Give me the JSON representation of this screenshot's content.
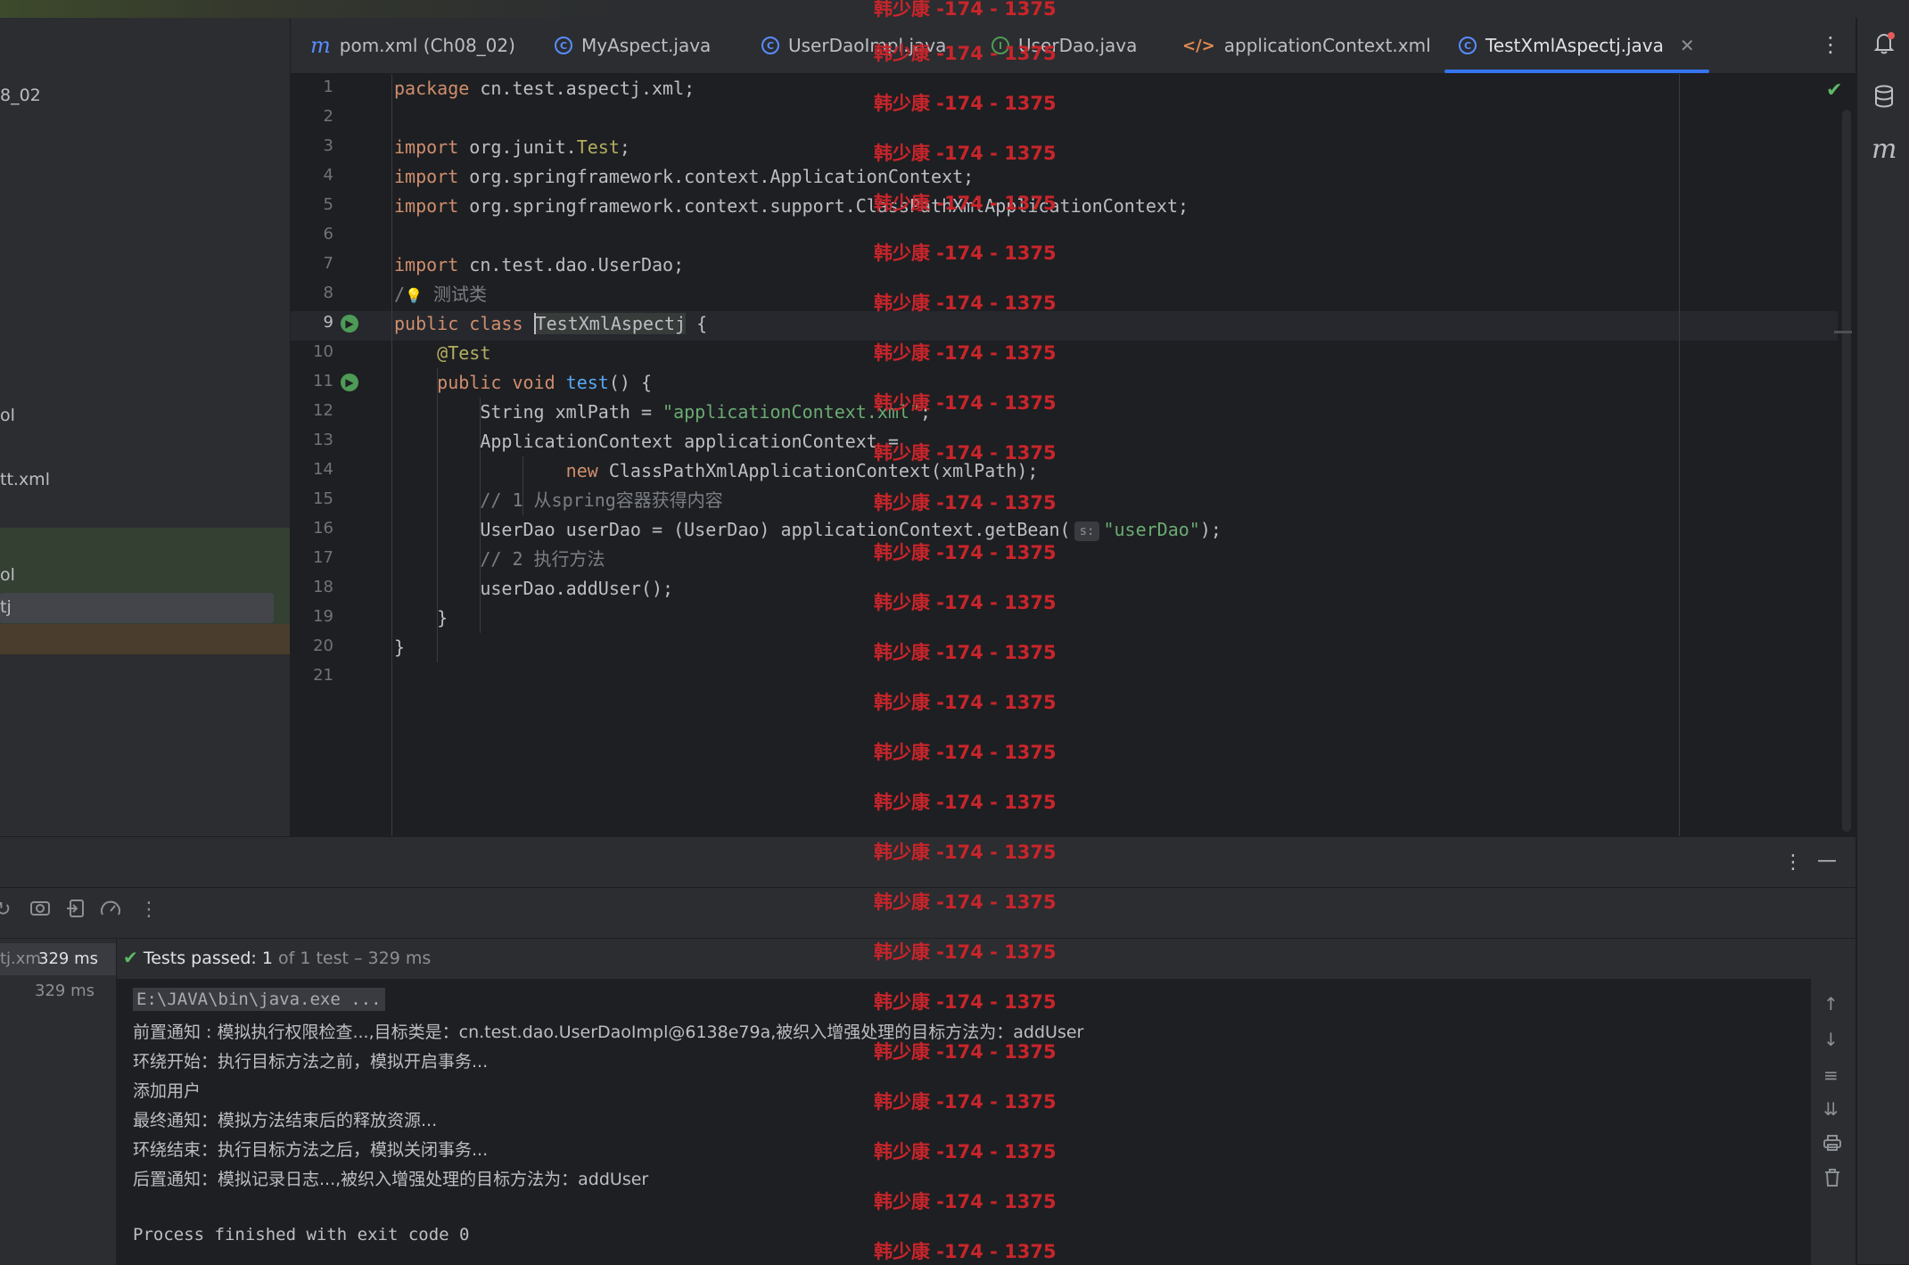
{
  "sidebar": {
    "items": [
      {
        "label": "8_02"
      },
      {
        "label": "ol"
      },
      {
        "label": "tt.xml"
      },
      {
        "label": "ol"
      },
      {
        "label": "tj"
      }
    ]
  },
  "tabs": [
    {
      "label": "pom.xml (Ch08_02)",
      "icon": "maven-icon"
    },
    {
      "label": "MyAspect.java",
      "icon": "class-icon"
    },
    {
      "label": "UserDaoImpl.java",
      "icon": "class-icon"
    },
    {
      "label": "UserDao.java",
      "icon": "interface-icon"
    },
    {
      "label": "applicationContext.xml",
      "icon": "xml-icon"
    },
    {
      "label": "TestXmlAspectj.java",
      "icon": "class-icon",
      "active": true
    }
  ],
  "editor": {
    "current_line": 9,
    "line_numbers": [
      "1",
      "2",
      "3",
      "4",
      "5",
      "6",
      "7",
      "8",
      "9",
      "10",
      "11",
      "12",
      "13",
      "14",
      "15",
      "16",
      "17",
      "18",
      "19",
      "20",
      "21"
    ],
    "code": {
      "l1": {
        "kw": "package",
        "rest": " cn.test.aspectj.xml;"
      },
      "l3": {
        "kw": "import",
        "rest": " org.junit.",
        "ann": "Test",
        "end": ";"
      },
      "l4": {
        "kw": "import",
        "rest": " org.springframework.context.ApplicationContext;"
      },
      "l5": {
        "kw": "import",
        "rest": " org.springframework.context.support.ClassPathXmlApplicationContext;"
      },
      "l7": {
        "kw": "import",
        "rest": " cn.test.dao.UserDao;"
      },
      "l8": {
        "prefix": "/",
        "cmt": " 测试类"
      },
      "l9": {
        "kw": "public class",
        "name": "TestXmlAspectj",
        "rest": " {"
      },
      "l10": {
        "ann": "@Test"
      },
      "l11": {
        "kw": "public void",
        "fn": "test",
        "rest": "() {"
      },
      "l12": {
        "pre": "String xmlPath = ",
        "str": "\"applicationContext.xml\"",
        "end": ";"
      },
      "l13": {
        "text": "ApplicationContext applicationContext ="
      },
      "l14": {
        "kw": "new",
        "rest": " ClassPathXmlApplicationContext(xmlPath);"
      },
      "l15": {
        "cmt": "// 1 从spring容器获得内容"
      },
      "l16": {
        "pre": "UserDao userDao = (UserDao) applicationContext.getBean(",
        "hint": "s:",
        "str": "\"userDao\"",
        "end": ");"
      },
      "l17": {
        "cmt": "// 2 执行方法"
      },
      "l18": {
        "text": "userDao.addUser();"
      },
      "l19": {
        "text": "}"
      },
      "l20": {
        "text": "}"
      }
    }
  },
  "run": {
    "tree": [
      {
        "label": "tj.xm",
        "time": "329 ms"
      },
      {
        "label": "",
        "time": "329 ms"
      }
    ],
    "status_prefix": "Tests passed: ",
    "status_count": "1",
    "status_suffix": " of 1 test – 329 ms",
    "console": [
      "E:\\JAVA\\bin\\java.exe ...",
      "前置通知 : 模拟执行权限检查...,目标类是：cn.test.dao.UserDaoImpl@6138e79a,被织入增强处理的目标方法为：addUser",
      "环绕开始：执行目标方法之前，模拟开启事务...",
      "添加用户",
      "最终通知：模拟方法结束后的释放资源...",
      "环绕结束：执行目标方法之后，模拟关闭事务...",
      "后置通知：模拟记录日志...,被织入增强处理的目标方法为：addUser",
      "",
      "Process finished with exit code 0"
    ]
  },
  "watermark": {
    "text": "韩少康 -174 - 1375"
  },
  "colors": {
    "accent": "#3574f0",
    "keyword": "#cf8e6d",
    "string": "#6aab73",
    "annotation": "#b3ae60",
    "success": "#5fb865",
    "watermark": "#c8252b"
  }
}
